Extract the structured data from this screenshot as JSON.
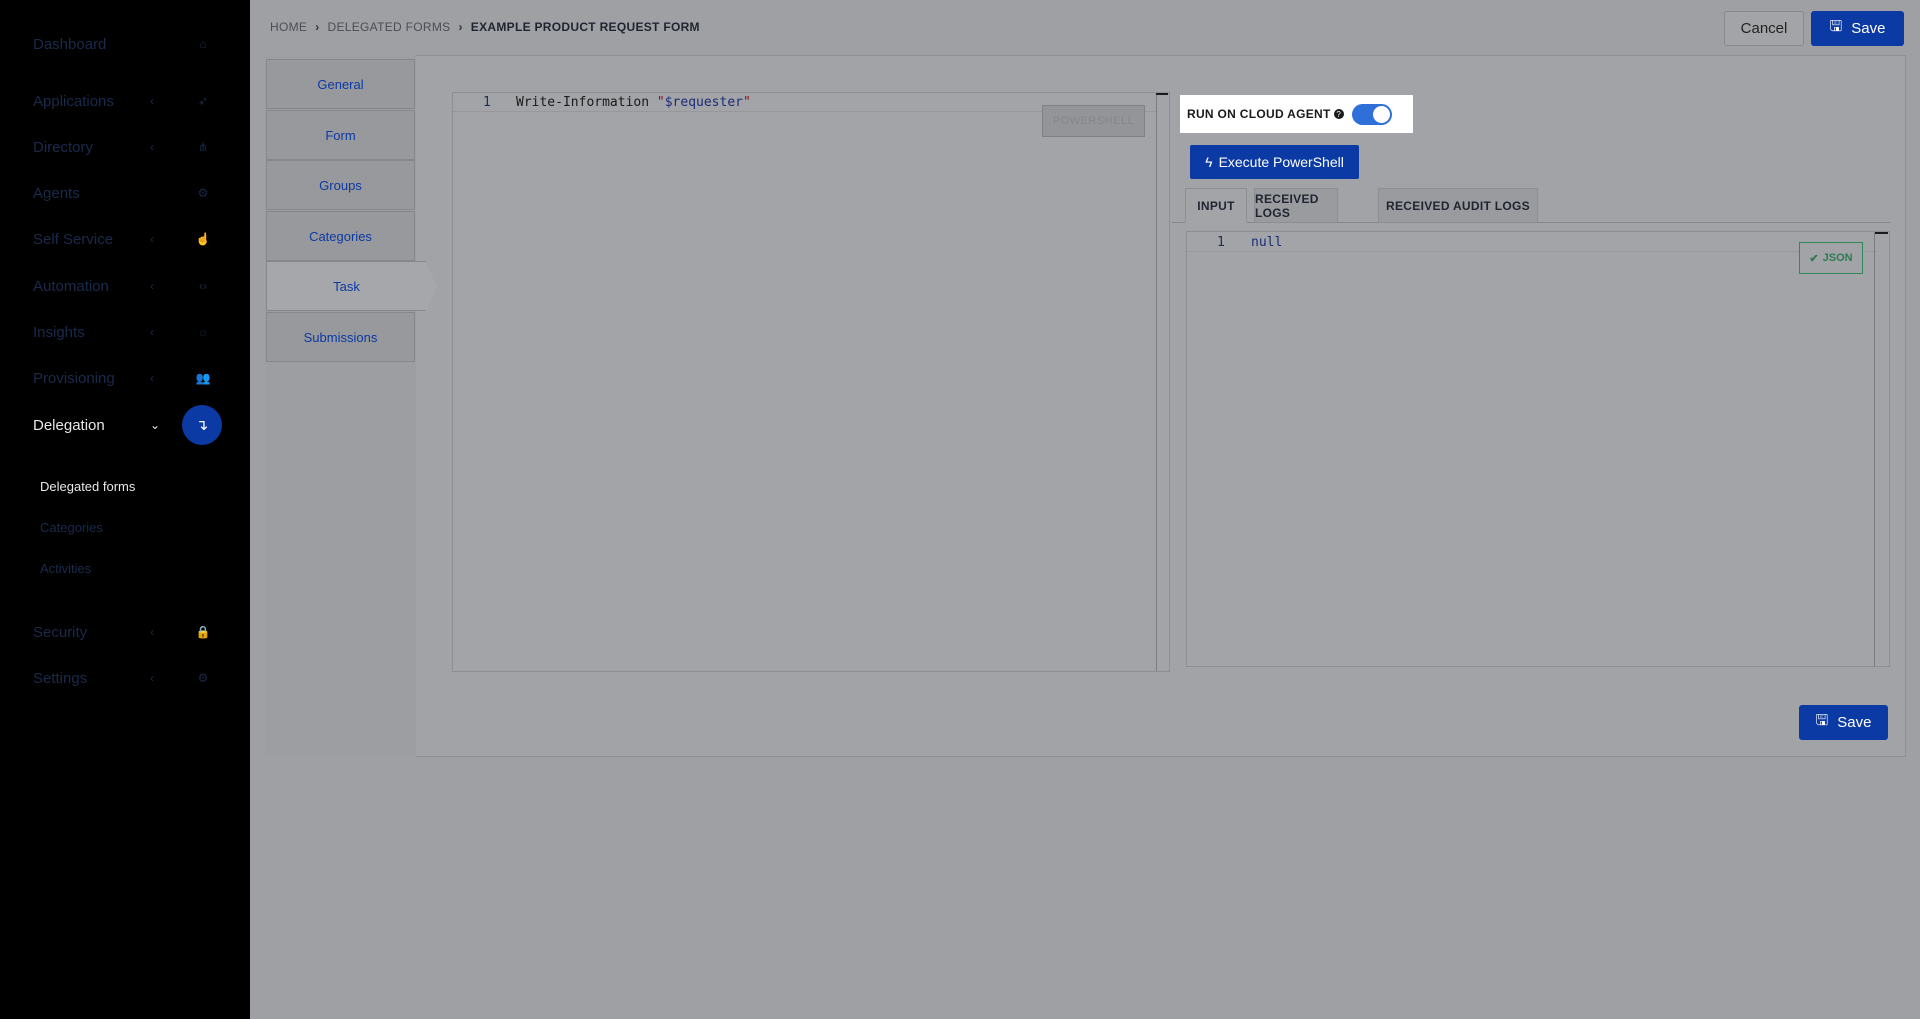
{
  "sidebar": {
    "items": [
      {
        "label": "Dashboard",
        "chevron": "",
        "icon": "⌂",
        "icon_name": "home-icon"
      },
      {
        "label": "Applications",
        "chevron": "‹",
        "icon": "➶",
        "icon_name": "rocket-icon"
      },
      {
        "label": "Directory",
        "chevron": "‹",
        "icon": "⋔",
        "icon_name": "sitemap-icon"
      },
      {
        "label": "Agents",
        "chevron": "",
        "icon": "⚙",
        "icon_name": "cogs-icon"
      },
      {
        "label": "Self Service",
        "chevron": "‹",
        "icon": "☝",
        "icon_name": "hand-pointer-icon"
      },
      {
        "label": "Automation",
        "chevron": "‹",
        "icon": "‹›",
        "icon_name": "code-icon"
      },
      {
        "label": "Insights",
        "chevron": "‹",
        "icon": "☼",
        "icon_name": "lightbulb-icon"
      },
      {
        "label": "Provisioning",
        "chevron": "‹",
        "icon": "👥",
        "icon_name": "users-icon"
      },
      {
        "label": "Delegation",
        "chevron": "⌄",
        "icon": "↴",
        "icon_name": "level-down-icon"
      },
      {
        "label": "Security",
        "chevron": "‹",
        "icon": "🔒",
        "icon_name": "lock-icon"
      },
      {
        "label": "Settings",
        "chevron": "‹",
        "icon": "⚙",
        "icon_name": "gear-icon"
      }
    ],
    "submenu": [
      "Delegated forms",
      "Categories",
      "Activities"
    ]
  },
  "breadcrumb": {
    "home": "HOME",
    "parent": "DELEGATED FORMS",
    "current": "EXAMPLE PRODUCT REQUEST FORM",
    "separator": "›"
  },
  "toolbar": {
    "cancel_label": "Cancel",
    "save_label": "Save",
    "save_icon": "🖫"
  },
  "vertical_tabs": [
    "General",
    "Form",
    "Groups",
    "Categories",
    "Task",
    "Submissions"
  ],
  "active_tab": "Task",
  "script_editor": {
    "line_number": "1",
    "code_cmd": "Write-Information ",
    "code_str_open": "\"",
    "code_var": "$requester",
    "code_str_close": "\"",
    "language": "POWERSHELL"
  },
  "cloud_agent": {
    "label": "RUN ON CLOUD AGENT",
    "help": "?",
    "enabled": true
  },
  "execute": {
    "label": "Execute PowerShell",
    "icon": "ϟ"
  },
  "output_tabs": [
    "INPUT",
    "RECEIVED LOGS",
    "RECEIVED AUDIT LOGS"
  ],
  "input_editor": {
    "line_number": "1",
    "value": "null",
    "badge": "JSON",
    "badge_icon": "✔"
  },
  "colors": {
    "accent": "#0b3aa4",
    "toggle": "#2f6fd8",
    "json_valid": "#2f7a52"
  }
}
